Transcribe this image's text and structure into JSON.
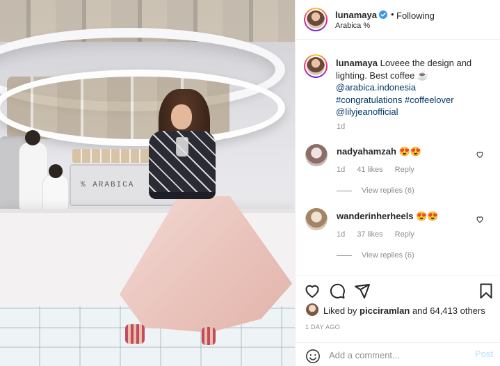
{
  "post": {
    "username": "lunamaya",
    "follow_state": "Following",
    "separator": "•",
    "location": "Arabica %",
    "caption": {
      "line1": "Loveee the design and",
      "line2": "lighting. Best coffee ☕",
      "mention1": "@arabica.indonesia",
      "hashtags": "#congratulations #coffeelover",
      "mention2": "@lilyjeanofficial",
      "age": "1d"
    },
    "photo_sign_text": "% ARABICA"
  },
  "comments": [
    {
      "username": "nadyahamzah",
      "text": "😍😍",
      "age": "1d",
      "likes": "41 likes",
      "reply": "Reply",
      "view_replies": "View replies (6)"
    },
    {
      "username": "wanderinherheels",
      "text": "😍😍",
      "age": "1d",
      "likes": "37 likes",
      "reply": "Reply",
      "view_replies": "View replies (6)"
    }
  ],
  "actions": {
    "icons": [
      "heart-icon",
      "comment-icon",
      "share-icon",
      "bookmark-icon"
    ],
    "liked_by_prefix": "Liked by",
    "liked_by_user": "picciramlan",
    "liked_by_suffix": "and 64,413 others",
    "time_ago": "1 DAY AGO"
  },
  "add_comment": {
    "placeholder": "Add a comment...",
    "post_label": "Post"
  },
  "colors": {
    "link": "#00376b",
    "verified": "#3897f0",
    "muted": "#8e8e8e",
    "post_disabled": "#b2dffc"
  }
}
